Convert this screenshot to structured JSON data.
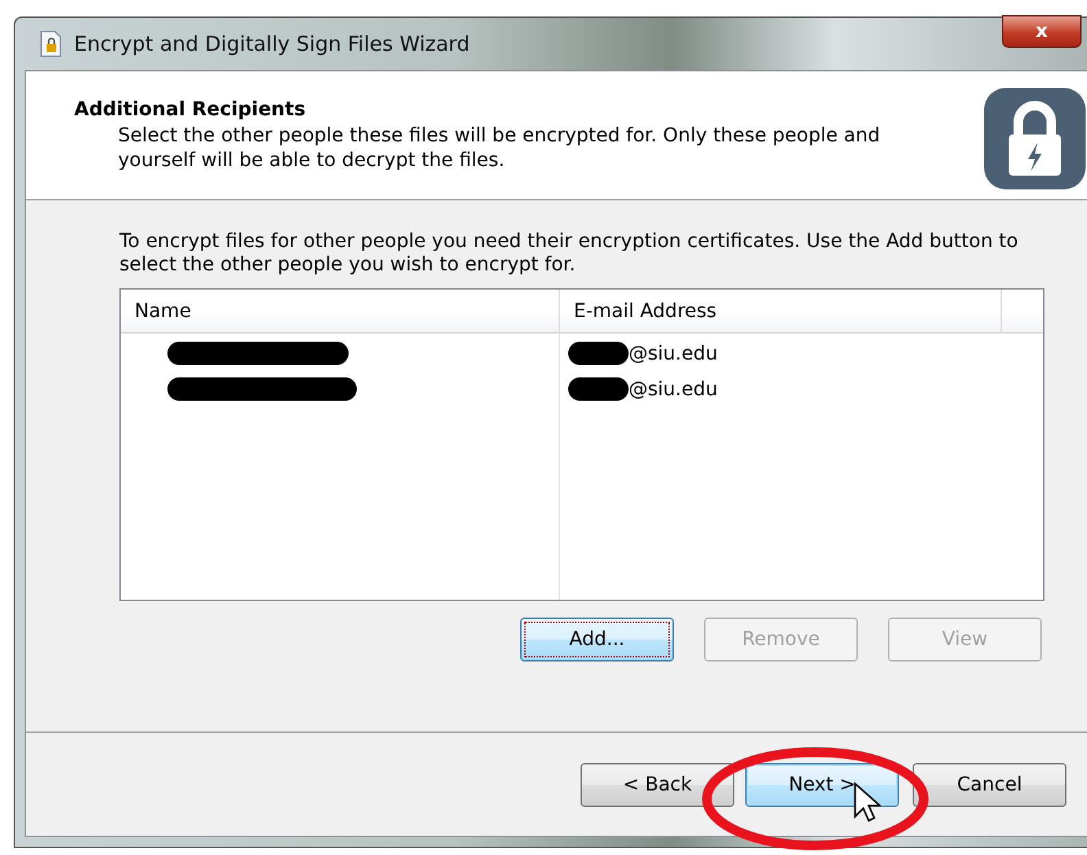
{
  "window": {
    "title": "Encrypt and Digitally Sign Files Wizard",
    "close": "x"
  },
  "header": {
    "title": "Additional Recipients",
    "description": "Select the other people these files will be encrypted for.  Only these people and yourself will be able to decrypt the files."
  },
  "instructions": "To encrypt files for other people you need their encryption certificates.  Use the Add button to select the other people you wish to encrypt for.",
  "table": {
    "columns": [
      "Name",
      "E-mail Address"
    ],
    "rows": [
      {
        "name_redacted": true,
        "email": "@siu.edu",
        "email_redacted": true
      },
      {
        "name_redacted": true,
        "email": "@siu.edu",
        "email_redacted": true
      }
    ]
  },
  "list_buttons": [
    {
      "label": "Add...",
      "disabled": false,
      "focused": true
    },
    {
      "label": "Remove",
      "disabled": true,
      "focused": false
    },
    {
      "label": "View",
      "disabled": true,
      "focused": false
    }
  ],
  "nav_buttons": [
    {
      "label": "< Back",
      "default": false
    },
    {
      "label": "Next >",
      "default": true
    },
    {
      "label": "Cancel",
      "default": false
    }
  ]
}
